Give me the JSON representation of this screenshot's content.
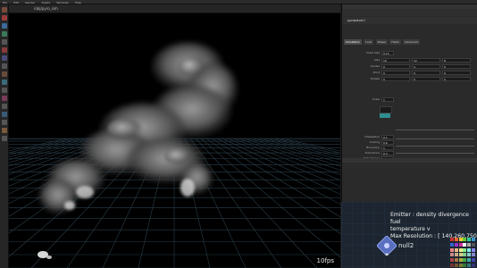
{
  "topbar": {
    "tabs": [
      "File",
      "Edit",
      "Render",
      "Assets",
      "Windows",
      "Help"
    ]
  },
  "viewport": {
    "path_label": "/obj/pyro_sim",
    "fps_label": "10fps"
  },
  "parameter_panel": {
    "node_label": "pyrosolver1",
    "tabs": [
      "Simulation",
      "Look",
      "Shape",
      "Fields",
      "Advanced"
    ],
    "rows": [
      {
        "label": "Voxel Size",
        "values": [
          "0.15"
        ]
      },
      {
        "label": "Size",
        "values": [
          "10",
          "12",
          "8"
        ]
      },
      {
        "label": "Center",
        "values": [
          "0",
          "4",
          "0"
        ]
      },
      {
        "label": "Pivot",
        "values": [
          "0",
          "0",
          "0"
        ]
      },
      {
        "label": "Rotate",
        "values": [
          "0",
          "0",
          "0"
        ]
      },
      {
        "label": "Scale",
        "values": [
          "1"
        ]
      },
      {
        "label": "Dissipation",
        "values": [
          "0.1"
        ]
      },
      {
        "label": "Cooling",
        "values": [
          "0.6"
        ]
      },
      {
        "label": "Buoyancy",
        "values": [
          "1"
        ]
      },
      {
        "label": "Turbulence",
        "values": [
          "0.3"
        ]
      },
      {
        "label": "Disturbance",
        "values": [
          "0.2"
        ]
      }
    ]
  },
  "network": {
    "note_lines": [
      "Emitter : density divergence fuel",
      "temperature v",
      "Max Resolution : [ 140,260,750 ]"
    ],
    "node_name": "null2"
  },
  "colors": {
    "viewport_bg": "#000000",
    "panel_bg": "#2a2a2a",
    "network_bg": "#1c2530",
    "accent_teal": "#2f8e91",
    "smoke": "#6e6e6e"
  }
}
